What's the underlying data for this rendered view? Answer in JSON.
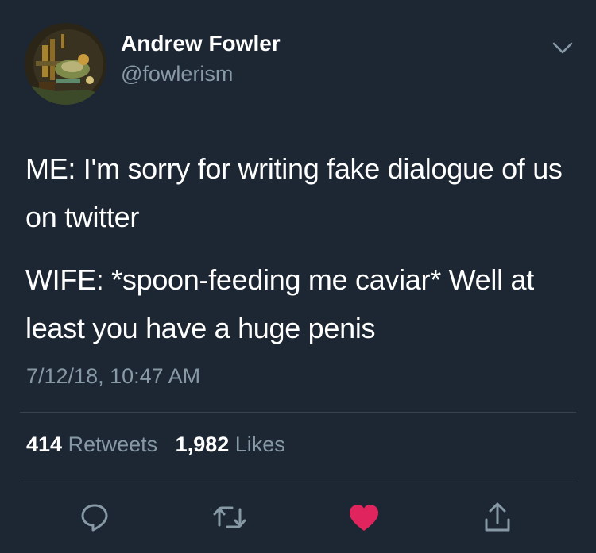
{
  "user": {
    "display_name": "Andrew Fowler",
    "handle": "@fowlerism",
    "avatar_icon": "avatar-image"
  },
  "tweet": {
    "line1": "ME: I'm sorry for writing fake dialogue of us on twitter",
    "line2": "WIFE: *spoon-feeding me caviar* Well at least you have a huge penis",
    "timestamp": "7/12/18, 10:47 AM"
  },
  "stats": {
    "retweets_count": "414",
    "retweets_label": "Retweets",
    "likes_count": "1,982",
    "likes_label": "Likes"
  },
  "actions": {
    "reply_icon": "reply-icon",
    "retweet_icon": "retweet-icon",
    "like_icon": "heart-icon",
    "share_icon": "share-icon"
  },
  "colors": {
    "background": "#1c2733",
    "secondary_text": "#8899a6",
    "like_active": "#e0245e",
    "divider": "#38444d"
  }
}
